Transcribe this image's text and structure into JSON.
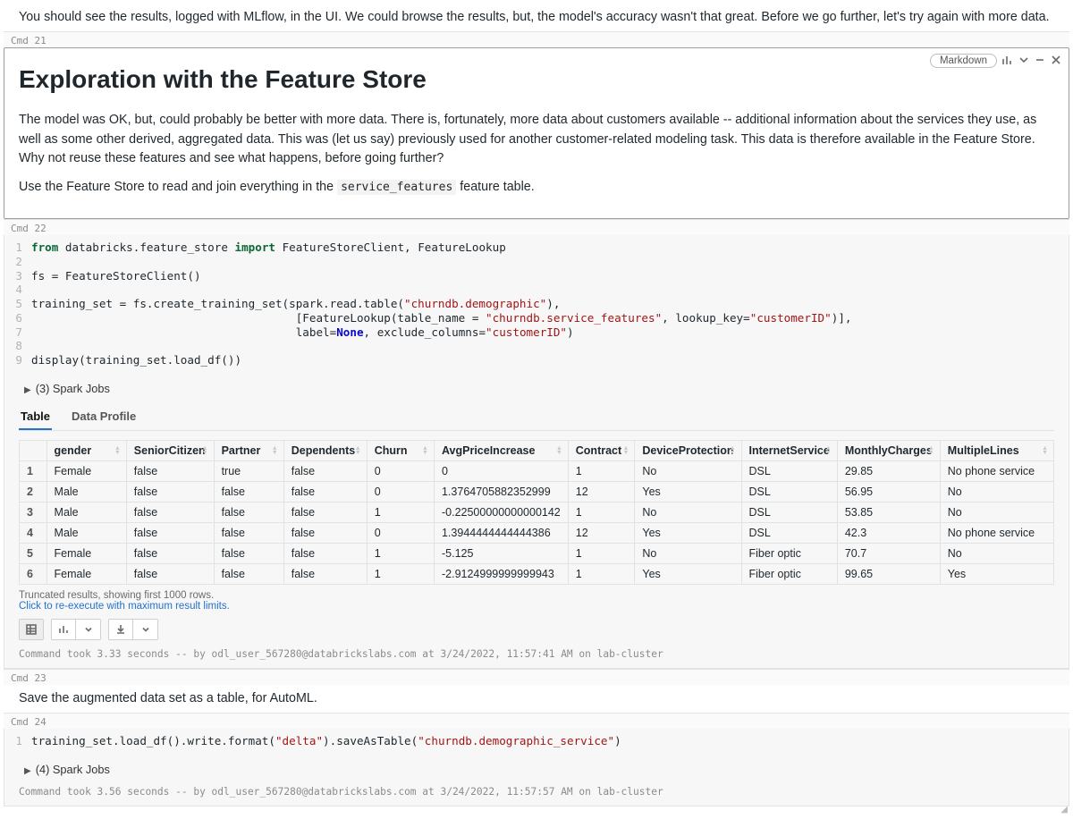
{
  "intro_text": "You should see the results, logged with MLflow, in the UI. We could browse the results, but, the model's accuracy wasn't that great. Before we go further, let's try again with more data.",
  "cmd21_label": "Cmd 21",
  "cmd22_label": "Cmd 22",
  "cmd23_label": "Cmd 23",
  "cmd24_label": "Cmd 24",
  "lang_pill": "Markdown",
  "focused": {
    "heading": "Exploration with the Feature Store",
    "p1": "The model was OK, but, could probably be better with more data. There is, fortunately, more data about customers available -- additional information about the services they use, as well as some other derived, aggregated data. This was (let us say) previously used for another customer-related modeling task. This data is therefore available in the Feature Store. Why not reuse these features and see what happens, before going further?",
    "p2a": "Use the Feature Store to read and join everything in the ",
    "p2code": "service_features",
    "p2b": " feature table."
  },
  "code22": {
    "l1": {
      "pre": "",
      "kw": "from",
      "a": " databricks.feature_store ",
      "kw2": "import",
      "b": " FeatureStoreClient, FeatureLookup"
    },
    "l3": "fs = FeatureStoreClient()",
    "l5": {
      "a": "training_set = fs.create_training_set(spark.read.table(",
      "s1": "\"churndb.demographic\"",
      "b": "),"
    },
    "l6": {
      "pad": "                                       ",
      "a": "[FeatureLookup(table_name = ",
      "s1": "\"churndb.service_features\"",
      "b": ", lookup_key=",
      "s2": "\"customerID\"",
      "c": ")],"
    },
    "l7": {
      "pad": "                                       ",
      "a": "label=",
      "none": "None",
      "b": ", exclude_columns=",
      "s1": "\"customerID\"",
      "c": ")"
    },
    "l9": "display(training_set.load_df())"
  },
  "spark_jobs_22": "(3) Spark Jobs",
  "tabs": {
    "table": "Table",
    "profile": "Data Profile"
  },
  "table": {
    "headers": [
      "gender",
      "SeniorCitizen",
      "Partner",
      "Dependents",
      "Churn",
      "AvgPriceIncrease",
      "Contract",
      "DeviceProtection",
      "InternetService",
      "MonthlyCharges",
      "MultipleLines"
    ],
    "rows": [
      [
        "Female",
        "false",
        "true",
        "false",
        "0",
        "0",
        "1",
        "No",
        "DSL",
        "29.85",
        "No phone service"
      ],
      [
        "Male",
        "false",
        "false",
        "false",
        "0",
        "1.3764705882352999",
        "12",
        "Yes",
        "DSL",
        "56.95",
        "No"
      ],
      [
        "Male",
        "false",
        "false",
        "false",
        "1",
        "-0.22500000000000142",
        "1",
        "No",
        "DSL",
        "53.85",
        "No"
      ],
      [
        "Male",
        "false",
        "false",
        "false",
        "0",
        "1.3944444444444386",
        "12",
        "Yes",
        "DSL",
        "42.3",
        "No phone service"
      ],
      [
        "Female",
        "false",
        "false",
        "false",
        "1",
        "-5.125",
        "1",
        "No",
        "Fiber optic",
        "70.7",
        "No"
      ],
      [
        "Female",
        "false",
        "false",
        "false",
        "1",
        "-2.9124999999999943",
        "1",
        "Yes",
        "Fiber optic",
        "99.65",
        "Yes"
      ]
    ]
  },
  "trunc_note": "Truncated results, showing first 1000 rows.",
  "trunc_link": "Click to re-execute with maximum result limits.",
  "status22": "Command took 3.33 seconds -- by odl_user_567280@databrickslabs.com at 3/24/2022, 11:57:41 AM on lab-cluster",
  "md23": "Save the augmented data set as a table, for AutoML.",
  "code24": {
    "a": "training_set.load_df().write.format(",
    "s1": "\"delta\"",
    "b": ").saveAsTable(",
    "s2": "\"churndb.demographic_service\"",
    "c": ")"
  },
  "spark_jobs_24": "(4) Spark Jobs",
  "status24": "Command took 3.56 seconds -- by odl_user_567280@databrickslabs.com at 3/24/2022, 11:57:57 AM on lab-cluster",
  "colwidths": [
    "32px",
    "96px",
    "98px",
    "82px",
    "94px",
    "80px",
    "138px",
    "76px",
    "118px",
    "106px",
    "114px",
    "130px"
  ]
}
